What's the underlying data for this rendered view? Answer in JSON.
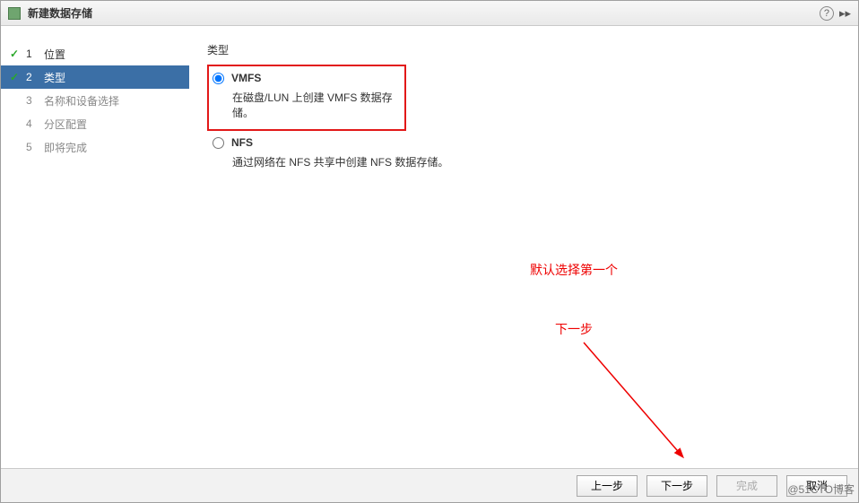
{
  "title": "新建数据存储",
  "sidebar": {
    "steps": [
      {
        "num": "1",
        "label": "位置",
        "state": "completed"
      },
      {
        "num": "2",
        "label": "类型",
        "state": "active"
      },
      {
        "num": "3",
        "label": "名称和设备选择",
        "state": "inactive"
      },
      {
        "num": "4",
        "label": "分区配置",
        "state": "inactive"
      },
      {
        "num": "5",
        "label": "即将完成",
        "state": "inactive"
      }
    ]
  },
  "main": {
    "heading": "类型",
    "options": [
      {
        "id": "vmfs",
        "label": "VMFS",
        "desc": "在磁盘/LUN 上创建 VMFS 数据存储。",
        "selected": true,
        "highlighted": true
      },
      {
        "id": "nfs",
        "label": "NFS",
        "desc": "通过网络在 NFS 共享中创建 NFS 数据存储。",
        "selected": false,
        "highlighted": false
      }
    ]
  },
  "annotations": {
    "a1": "默认选择第一个",
    "a2": "下一步"
  },
  "footer": {
    "back": "上一步",
    "next": "下一步",
    "finish": "完成",
    "cancel": "取消"
  },
  "watermark": "@51CTO博客",
  "help_glyph": "?",
  "expand_glyph": "▸▸"
}
